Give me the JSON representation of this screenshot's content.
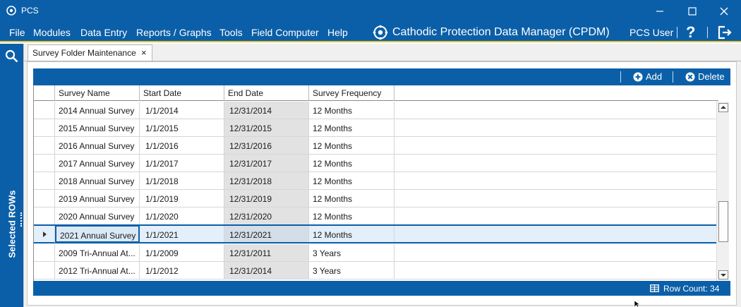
{
  "window": {
    "title": "PCS",
    "app_icon": "cog-icon",
    "controls": [
      "minimize-icon",
      "maximize-icon",
      "close-icon"
    ]
  },
  "menu": {
    "items": [
      {
        "label": "File"
      },
      {
        "label": "Modules"
      },
      {
        "label": "Data Entry"
      },
      {
        "label": "Reports / Graphs"
      },
      {
        "label": "Tools"
      },
      {
        "label": "Field Computer"
      },
      {
        "label": "Help"
      }
    ],
    "brand_text": "Cathodic Protection Data Manager (CPDM)",
    "brand_icon": "cpdm-logo-icon",
    "user_label": "PCS User",
    "help_label": "?",
    "logout_icon": "logout-icon"
  },
  "sidebar": {
    "search_icon": "search-icon",
    "label": "Selected ROWs"
  },
  "tabs": [
    {
      "label": "Survey Folder Maintenance",
      "close": "×"
    }
  ],
  "toolbar": {
    "add_label": "Add",
    "delete_label": "Delete"
  },
  "grid": {
    "columns": [
      "Survey Name",
      "Start Date",
      "End Date",
      "Survey Frequency"
    ],
    "rows": [
      {
        "name": "2014 Annual Survey",
        "start": "1/1/2014",
        "end": "12/31/2014",
        "freq": "12 Months"
      },
      {
        "name": "2015 Annual Survey",
        "start": "1/1/2015",
        "end": "12/31/2015",
        "freq": "12 Months"
      },
      {
        "name": "2016 Annual Survey",
        "start": "1/1/2016",
        "end": "12/31/2016",
        "freq": "12 Months"
      },
      {
        "name": "2017 Annual Survey",
        "start": "1/1/2017",
        "end": "12/31/2017",
        "freq": "12 Months"
      },
      {
        "name": "2018 Annual Survey",
        "start": "1/1/2018",
        "end": "12/31/2018",
        "freq": "12 Months"
      },
      {
        "name": "2019 Annual Survey",
        "start": "1/1/2019",
        "end": "12/31/2019",
        "freq": "12 Months"
      },
      {
        "name": "2020 Annual Survey",
        "start": "1/1/2020",
        "end": "12/31/2020",
        "freq": "12 Months"
      },
      {
        "name": "2021 Annual Survey",
        "start": "1/1/2021",
        "end": "12/31/2021",
        "freq": "12 Months"
      },
      {
        "name": "2009 Tri-Annual At...",
        "start": "1/1/2009",
        "end": "12/31/2011",
        "freq": "3 Years"
      },
      {
        "name": "2012 Tri-Annual At...",
        "start": "1/1/2012",
        "end": "12/31/2014",
        "freq": "3 Years"
      }
    ],
    "selected_row": "2021 Annual Survey"
  },
  "status": {
    "row_count_label": "Row Count:",
    "row_count": "34"
  },
  "colors": {
    "primary": "#0b5fa8",
    "accent_underline": "#e8c43a",
    "selected_row": "#e3effa",
    "end_date_cell": "#e2e2e2"
  }
}
